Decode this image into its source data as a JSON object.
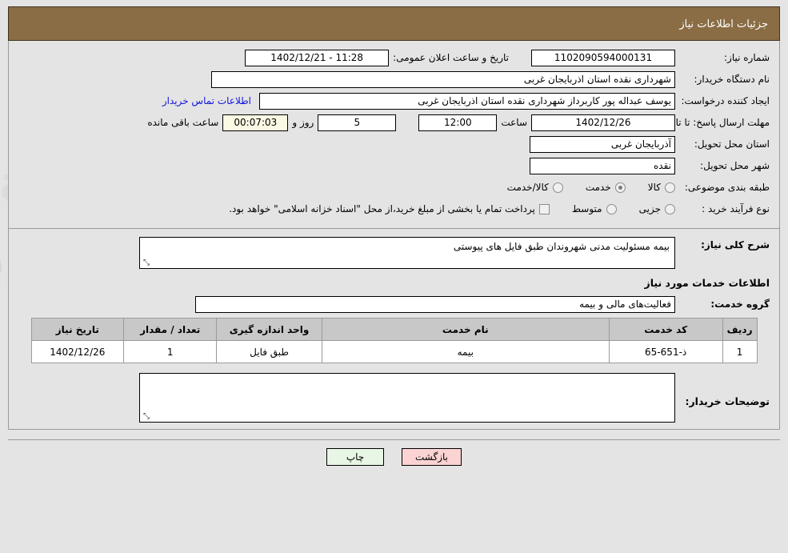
{
  "header": {
    "title": "جزئیات اطلاعات نیاز"
  },
  "colors": {
    "header_bg": "#8a6d44",
    "header_text": "#ffffff",
    "page_bg": "#e4e4e4",
    "link": "#1414dd",
    "field_bg": "#ffffff",
    "countdown_bg": "#fbf8e3",
    "table_header_bg": "#c8c8c8",
    "print_button_bg": "#e8f6e5",
    "back_button_bg": "#fbd3d3"
  },
  "form": {
    "need_number_label": "شماره نیاز:",
    "need_number_value": "1102090594000131",
    "announce_label": "تاریخ و ساعت اعلان عمومی:",
    "announce_value": "11:28 - 1402/12/21",
    "buyer_org_label": "نام دستگاه خریدار:",
    "buyer_org_value": "شهرداری نقده استان اذربایجان غربی",
    "creator_label": "ایجاد کننده درخواست:",
    "creator_value": "یوسف عبداله پور کاربرداز شهرداری نقده استان اذربایجان غربی",
    "contact_link": "اطلاعات تماس خریدار",
    "deadline_label": "مهلت ارسال پاسخ: تا تاریخ:",
    "deadline_date": "1402/12/26",
    "hour_word": "ساعت",
    "deadline_time": "12:00",
    "days_value": "5",
    "days_word": "روز و",
    "countdown_value": "00:07:03",
    "remaining_word": "ساعت باقی مانده",
    "province_label": "استان محل تحویل:",
    "province_value": "آذربایجان غربی",
    "city_label": "شهر محل تحویل:",
    "city_value": "نقده",
    "category_label": "طبقه بندی موضوعی:",
    "category_options": [
      {
        "label": "کالا",
        "selected": false
      },
      {
        "label": "خدمت",
        "selected": true
      },
      {
        "label": "کالا/خدمت",
        "selected": false
      }
    ],
    "process_label": "نوع فرآیند خرید :",
    "process_options": [
      {
        "label": "جزیی",
        "selected": false
      },
      {
        "label": "متوسط",
        "selected": false
      }
    ],
    "treasury_checkbox_checked": false,
    "treasury_note": "پرداخت تمام یا بخشی از مبلغ خرید،از محل \"اسناد خزانه اسلامی\" خواهد بود."
  },
  "description": {
    "label": "شرح کلی نیاز:",
    "value": "بیمه مسئولیت مدنی شهروندان طبق فایل های پیوستی"
  },
  "services": {
    "section_title": "اطلاعات خدمات مورد نیاز",
    "group_label": "گروه خدمت:",
    "group_value": "فعالیت‌های مالی و بیمه",
    "table": {
      "columns": [
        "ردیف",
        "کد خدمت",
        "نام خدمت",
        "واحد اندازه گیری",
        "تعداد / مقدار",
        "تاریخ نیاز"
      ],
      "rows": [
        {
          "radif": "1",
          "code": "ذ-651-65",
          "name": "بیمه",
          "unit": "طبق فایل",
          "qty": "1",
          "date": "1402/12/26"
        }
      ]
    }
  },
  "buyer_notes": {
    "label": "توضیحات خریدار:",
    "value": ""
  },
  "footer": {
    "print_label": "چاپ",
    "back_label": "بازگشت"
  },
  "watermark": {
    "text": "AriaTender.net"
  }
}
